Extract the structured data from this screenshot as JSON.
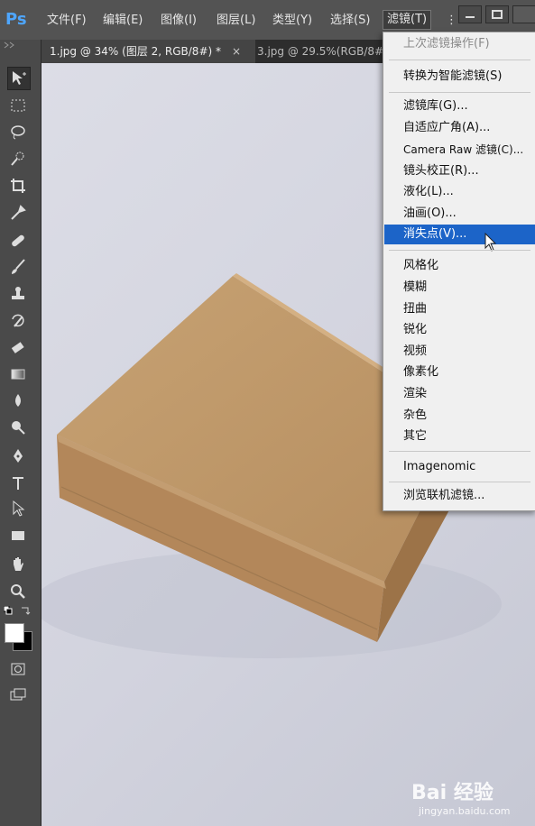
{
  "app": {
    "logo": "Ps"
  },
  "menubar": {
    "items": [
      "文件(F)",
      "编辑(E)",
      "图像(I)",
      "图层(L)",
      "类型(Y)",
      "选择(S)",
      "滤镜(T)"
    ],
    "active_index": 6,
    "overflow": "⋮"
  },
  "tabs": [
    {
      "label": "1.jpg @ 34% (图层 2, RGB/8#) *",
      "close": "×"
    },
    {
      "label": "3.jpg @ 29.5%(RGB/8#"
    }
  ],
  "filter_menu": {
    "items": [
      {
        "label": "上次滤镜操作(F)",
        "state": "disabled"
      },
      {
        "label": "转换为智能滤镜(S)"
      },
      {
        "label": "滤镜库(G)..."
      },
      {
        "label": "自适应广角(A)..."
      },
      {
        "label": "Camera Raw 滤镜(C)..."
      },
      {
        "label": "镜头校正(R)..."
      },
      {
        "label": "液化(L)..."
      },
      {
        "label": "油画(O)..."
      },
      {
        "label": "消失点(V)...",
        "state": "highlighted"
      },
      {
        "label": "风格化"
      },
      {
        "label": "模糊"
      },
      {
        "label": "扭曲"
      },
      {
        "label": "锐化"
      },
      {
        "label": "视频"
      },
      {
        "label": "像素化"
      },
      {
        "label": "渲染"
      },
      {
        "label": "杂色"
      },
      {
        "label": "其它"
      },
      {
        "label": "Imagenomic"
      },
      {
        "label": "浏览联机滤镜..."
      }
    ]
  },
  "tools": [
    "move-tool-icon",
    "marquee-tool-icon",
    "lasso-tool-icon",
    "quick-select-tool-icon",
    "crop-tool-icon",
    "eyedropper-tool-icon",
    "healing-brush-icon",
    "brush-tool-icon",
    "clone-stamp-icon",
    "history-brush-icon",
    "eraser-tool-icon",
    "gradient-tool-icon",
    "blur-tool-icon",
    "dodge-tool-icon",
    "pen-tool-icon",
    "type-tool-icon",
    "path-select-icon",
    "rectangle-tool-icon",
    "hand-tool-icon",
    "zoom-tool-icon"
  ],
  "colors": {
    "foreground": "#ffffff",
    "background": "#000000",
    "highlight": "#1c64c8",
    "box": "#c49a6c"
  },
  "watermark": {
    "text": "Bai 经验",
    "sub": "jingyan.baidu.com"
  }
}
